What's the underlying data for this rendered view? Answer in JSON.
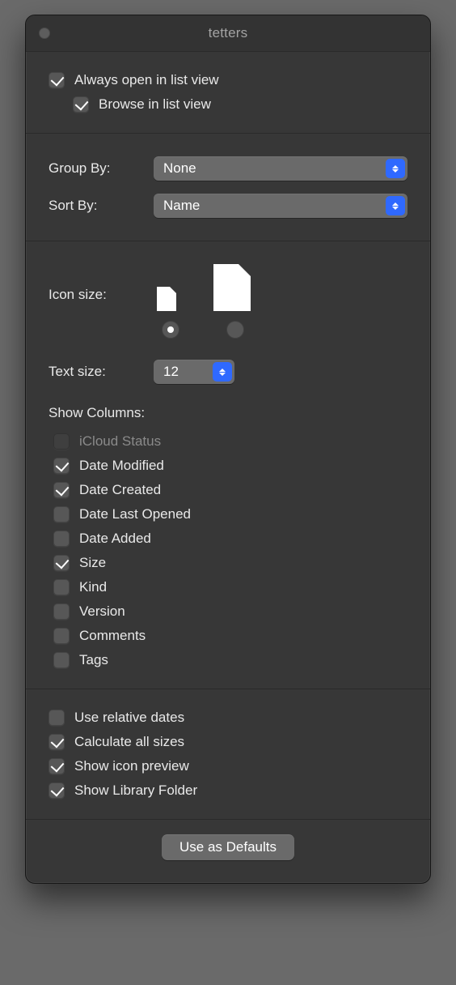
{
  "window": {
    "title": "tetters"
  },
  "top": {
    "always_open_label": "Always open in list view",
    "always_open_checked": true,
    "browse_label": "Browse in list view",
    "browse_checked": true
  },
  "group_sort": {
    "group_by_label": "Group By:",
    "group_by_value": "None",
    "sort_by_label": "Sort By:",
    "sort_by_value": "Name"
  },
  "icon": {
    "label": "Icon size:",
    "selected": "small"
  },
  "text_size": {
    "label": "Text size:",
    "value": "12"
  },
  "columns": {
    "heading": "Show Columns:",
    "items": [
      {
        "label": "iCloud Status",
        "checked": false,
        "disabled": true
      },
      {
        "label": "Date Modified",
        "checked": true,
        "disabled": false
      },
      {
        "label": "Date Created",
        "checked": true,
        "disabled": false
      },
      {
        "label": "Date Last Opened",
        "checked": false,
        "disabled": false
      },
      {
        "label": "Date Added",
        "checked": false,
        "disabled": false
      },
      {
        "label": "Size",
        "checked": true,
        "disabled": false
      },
      {
        "label": "Kind",
        "checked": false,
        "disabled": false
      },
      {
        "label": "Version",
        "checked": false,
        "disabled": false
      },
      {
        "label": "Comments",
        "checked": false,
        "disabled": false
      },
      {
        "label": "Tags",
        "checked": false,
        "disabled": false
      }
    ]
  },
  "options": {
    "items": [
      {
        "label": "Use relative dates",
        "checked": false
      },
      {
        "label": "Calculate all sizes",
        "checked": true
      },
      {
        "label": "Show icon preview",
        "checked": true
      },
      {
        "label": "Show Library Folder",
        "checked": true
      }
    ]
  },
  "footer": {
    "defaults_button": "Use as Defaults"
  }
}
